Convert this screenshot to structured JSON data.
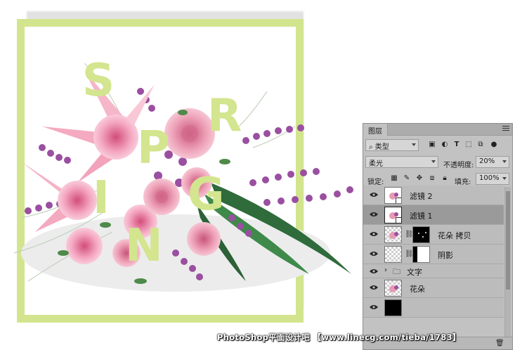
{
  "poster": {
    "letters": [
      "S",
      "P",
      "R",
      "I",
      "N",
      "G"
    ],
    "frame_color": "#d2e58e",
    "letter_color": "#d3e58e"
  },
  "layers_panel": {
    "tab_label": "图层",
    "filter_kind": "类型",
    "blend_mode": "柔光",
    "opacity_label": "不透明度:",
    "opacity_value": "20%",
    "lock_label": "锁定:",
    "fill_label": "填充:",
    "fill_value": "100%",
    "layers": [
      {
        "name": "滤镜 2",
        "type": "smart-object",
        "selected": false
      },
      {
        "name": "滤镜 1",
        "type": "smart-object",
        "selected": true
      },
      {
        "name": "花朵 拷贝",
        "type": "masked",
        "selected": false
      },
      {
        "name": "阴影",
        "type": "masked",
        "selected": false
      },
      {
        "name": "文字",
        "type": "group",
        "selected": false
      },
      {
        "name": "花朵",
        "type": "pixel",
        "selected": false
      }
    ]
  },
  "watermark": "PhotoShop平面设计吧 【www.linecg.com/tieba/1783】"
}
